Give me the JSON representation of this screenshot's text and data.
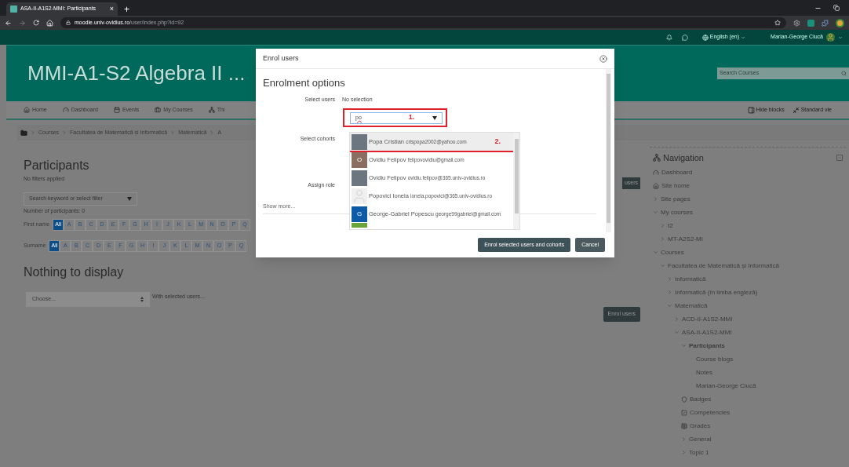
{
  "browser": {
    "tab_title": "ASA-II-A1S2-MMI: Participants",
    "tab_close": "×",
    "new_tab": "+",
    "url_host": "moodle.univ-ovidius.ro",
    "url_path": "/user/index.php?id=92"
  },
  "topbar": {
    "language": "English (en)",
    "user_name": "Marian-George Ciucă"
  },
  "header": {
    "course_title": "MMI-A1-S2 Algebra II ...",
    "search_placeholder": "Search Courses"
  },
  "navbar": {
    "items": [
      {
        "kind": "home",
        "label": "Home"
      },
      {
        "kind": "dashboard",
        "label": "Dashboard"
      },
      {
        "kind": "events",
        "label": "Events"
      },
      {
        "kind": "courses",
        "label": "My Courses"
      },
      {
        "kind": "course",
        "label": "Thi"
      }
    ],
    "right_items": [
      {
        "kind": "blocks",
        "label": "Hide blocks"
      },
      {
        "kind": "view",
        "label": "Standard vie"
      }
    ]
  },
  "breadcrumb": [
    "Courses",
    "Facultatea de Matematică și Informatică",
    "Matematică",
    "A"
  ],
  "participants": {
    "heading": "Participants",
    "filters_note": "No filters applied",
    "search_placeholder": "Search keyword or select filter",
    "count": "Number of participants: 0",
    "first_name_label": "First name",
    "surname_label": "Surname",
    "first_name_letters": [
      {
        "label": "All",
        "selected": true
      },
      {
        "label": "A",
        "selected": false
      },
      {
        "label": "B",
        "selected": false
      },
      {
        "label": "C",
        "selected": false
      },
      {
        "label": "D",
        "selected": false
      },
      {
        "label": "E",
        "selected": false
      },
      {
        "label": "F",
        "selected": false
      },
      {
        "label": "G",
        "selected": false
      },
      {
        "label": "H",
        "selected": false
      },
      {
        "label": "I",
        "selected": false
      },
      {
        "label": "J",
        "selected": false
      },
      {
        "label": "K",
        "selected": false
      },
      {
        "label": "L",
        "selected": false
      },
      {
        "label": "M",
        "selected": false
      },
      {
        "label": "N",
        "selected": false
      },
      {
        "label": "O",
        "selected": false
      },
      {
        "label": "P",
        "selected": false
      },
      {
        "label": "Q",
        "selected": false
      }
    ],
    "surname_letters": [
      {
        "label": "All",
        "selected": true
      },
      {
        "label": "A",
        "selected": false
      },
      {
        "label": "B",
        "selected": false
      },
      {
        "label": "C",
        "selected": false
      },
      {
        "label": "D",
        "selected": false
      },
      {
        "label": "E",
        "selected": false
      },
      {
        "label": "F",
        "selected": false
      },
      {
        "label": "G",
        "selected": false
      },
      {
        "label": "H",
        "selected": false
      },
      {
        "label": "I",
        "selected": false
      },
      {
        "label": "J",
        "selected": false
      },
      {
        "label": "K",
        "selected": false
      },
      {
        "label": "L",
        "selected": false
      },
      {
        "label": "M",
        "selected": false
      },
      {
        "label": "N",
        "selected": false
      },
      {
        "label": "O",
        "selected": false
      },
      {
        "label": "P",
        "selected": false
      },
      {
        "label": "Q",
        "selected": false
      }
    ],
    "enrol_button_top": "users",
    "empty_heading": "Nothing to display",
    "bulk_placeholder": "Choose...",
    "bulk_label": "With selected users...",
    "enrol_button": "Enrol users"
  },
  "modal": {
    "title": "Enrol users",
    "heading": "Enrolment options",
    "select_users_label": "Select users",
    "select_users_value": "No selection",
    "search_value": "po",
    "annotation_1": "1.",
    "annotation_2": "2.",
    "select_cohorts_label": "Select cohorts",
    "assign_role_label": "Assign role",
    "show_more": "Show more...",
    "options": [
      {
        "kind": "photo",
        "name": "Popa Cristian",
        "email": "crispopa2002@yahoo.com",
        "selected": true
      },
      {
        "kind": "letter",
        "letter": "O",
        "color": "#8a6e62",
        "name": "Ovidiu Felipov",
        "email": "felipovovidiu@gmail.com",
        "selected": false
      },
      {
        "kind": "photo",
        "name": "Ovidiu Felipov",
        "email": "ovidiu.felipov@365.univ-ovidius.ro",
        "selected": false
      },
      {
        "kind": "blank",
        "name": "Popovici Ionela",
        "email": "ionela.popovici@365.univ-ovidius.ro",
        "selected": false
      },
      {
        "kind": "letter",
        "letter": "G",
        "color": "#0d5aa7",
        "name": "George-Gabriel Popescu",
        "email": "george99gabriel@gmail.com",
        "selected": false
      }
    ],
    "buttons": [
      {
        "kind": "primary",
        "label": "Enrol selected users and cohorts"
      },
      {
        "kind": "secondary",
        "label": "Cancel"
      }
    ]
  },
  "navigation": {
    "title": "Navigation",
    "items": [
      {
        "kind": "dashboard",
        "label": "Dashboard",
        "selected": false
      },
      {
        "kind": "home",
        "label": "Site home",
        "selected": false
      },
      {
        "kind": "branch",
        "label": "Site pages",
        "expanded": false,
        "selected": false
      },
      {
        "kind": "branch",
        "label": "My courses",
        "expanded": true,
        "selected": false,
        "children": [
          {
            "kind": "branch",
            "label": "t2",
            "expanded": false,
            "selected": false
          },
          {
            "kind": "branch",
            "label": "MT-A2S2-MI",
            "expanded": false,
            "selected": false
          }
        ]
      },
      {
        "kind": "branch",
        "label": "Courses",
        "expanded": true,
        "selected": false,
        "children": [
          {
            "kind": "branch",
            "label": "Facultatea de Matematică și Informatică",
            "expanded": true,
            "selected": false,
            "children": [
              {
                "kind": "branch",
                "label": "Informatică",
                "expanded": false,
                "selected": false
              },
              {
                "kind": "branch",
                "label": "Informatică (în limba engleză)",
                "expanded": false,
                "selected": false
              },
              {
                "kind": "branch",
                "label": "Matematică",
                "expanded": true,
                "selected": false,
                "children": [
                  {
                    "kind": "branch",
                    "label": "ACD-II-A1S2-MMI",
                    "expanded": false,
                    "selected": false
                  },
                  {
                    "kind": "branch",
                    "label": "ASA-II-A1S2-MMI",
                    "expanded": true,
                    "selected": false,
                    "children": [
                      {
                        "kind": "branch",
                        "label": "Participants",
                        "expanded": true,
                        "selected": true,
                        "children": [
                          {
                            "kind": "leaf",
                            "label": "Course blogs",
                            "selected": false
                          },
                          {
                            "kind": "leaf",
                            "label": "Notes",
                            "selected": false
                          },
                          {
                            "kind": "leaf",
                            "label": "Marian-George Ciucă",
                            "selected": false
                          }
                        ]
                      },
                      {
                        "kind": "badges",
                        "label": "Badges",
                        "selected": false
                      },
                      {
                        "kind": "competencies",
                        "label": "Competencies",
                        "selected": false
                      },
                      {
                        "kind": "grades",
                        "label": "Grades",
                        "selected": false
                      },
                      {
                        "kind": "branch",
                        "label": "General",
                        "expanded": false,
                        "selected": false
                      },
                      {
                        "kind": "branch",
                        "label": "Topic 1",
                        "expanded": false,
                        "selected": false
                      }
                    ]
                  }
                ]
              }
            ]
          }
        ]
      }
    ]
  }
}
